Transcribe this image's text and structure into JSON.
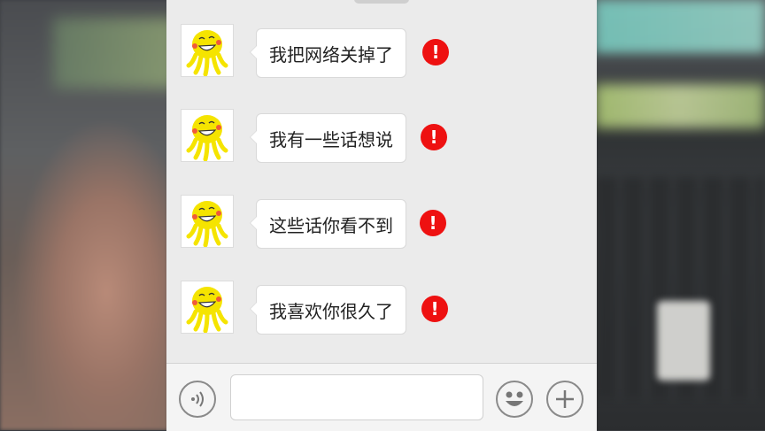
{
  "chat": {
    "messages": [
      {
        "text": "我把网络关掉了",
        "status": "!"
      },
      {
        "text": "我有一些话想说",
        "status": "!"
      },
      {
        "text": "这些话你看不到",
        "status": "!"
      },
      {
        "text": "我喜欢你很久了",
        "status": "!"
      }
    ]
  },
  "input_bar": {
    "message_value": "",
    "icons": [
      "voice-icon",
      "emoji-icon",
      "plus-icon"
    ]
  },
  "colors": {
    "panel_bg": "#ebebeb",
    "bubble_bg": "#ffffff",
    "error_red": "#ee1111",
    "avatar_yellow": "#f5e400"
  }
}
